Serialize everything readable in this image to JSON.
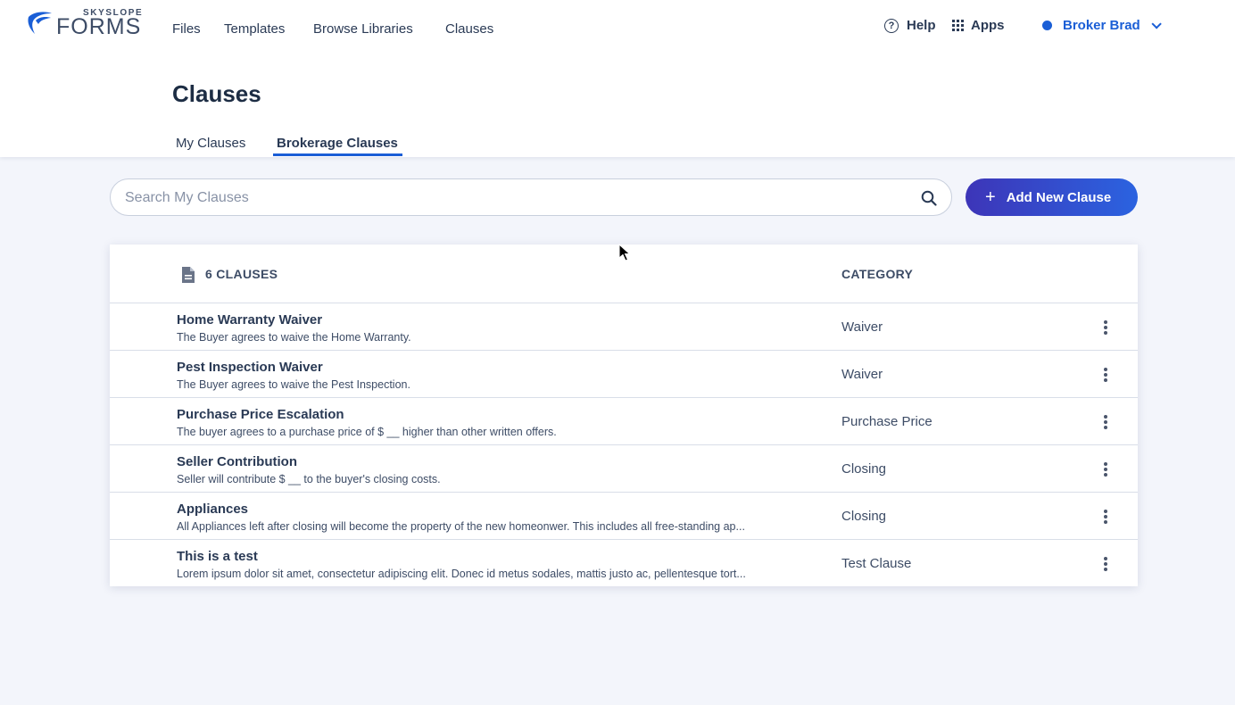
{
  "brand": {
    "small": "SKYSLOPE",
    "big": "FORMS"
  },
  "nav": [
    {
      "label": "Files"
    },
    {
      "label": "Templates"
    },
    {
      "label": "Browse Libraries"
    },
    {
      "label": "Clauses"
    }
  ],
  "right_nav": {
    "help": "Help",
    "apps": "Apps",
    "user": "Broker Brad"
  },
  "page": {
    "title": "Clauses"
  },
  "tabs": [
    {
      "label": "My Clauses",
      "active": false
    },
    {
      "label": "Brokerage Clauses",
      "active": true
    }
  ],
  "search": {
    "placeholder": "Search My Clauses",
    "value": ""
  },
  "add_button": {
    "label": "Add New Clause"
  },
  "table": {
    "count_label": "6 CLAUSES",
    "category_header": "CATEGORY",
    "rows": [
      {
        "title": "Home Warranty Waiver",
        "desc": "The Buyer agrees to waive the Home Warranty.",
        "category": "Waiver"
      },
      {
        "title": "Pest Inspection Waiver",
        "desc": "The Buyer agrees to waive the Pest Inspection.",
        "category": "Waiver"
      },
      {
        "title": "Purchase Price Escalation",
        "desc": "The buyer agrees to a purchase price of $ __ higher than other written offers.",
        "category": "Purchase Price"
      },
      {
        "title": "Seller Contribution",
        "desc": "Seller will contribute $ __ to the buyer's closing costs.",
        "category": "Closing"
      },
      {
        "title": "Appliances",
        "desc": "All Appliances left after closing will become the property of the new homeonwer. This includes all free-standing ap...",
        "category": "Closing"
      },
      {
        "title": "This is a test",
        "desc": "Lorem ipsum dolor sit amet, consectetur adipiscing elit. Donec id metus sodales, mattis justo ac, pellentesque tort...",
        "category": "Test Clause"
      }
    ]
  },
  "colors": {
    "accent": "#1a5ed6",
    "button_start": "#3d35b8",
    "button_end": "#2b63e0",
    "background": "#f3f5fb"
  }
}
